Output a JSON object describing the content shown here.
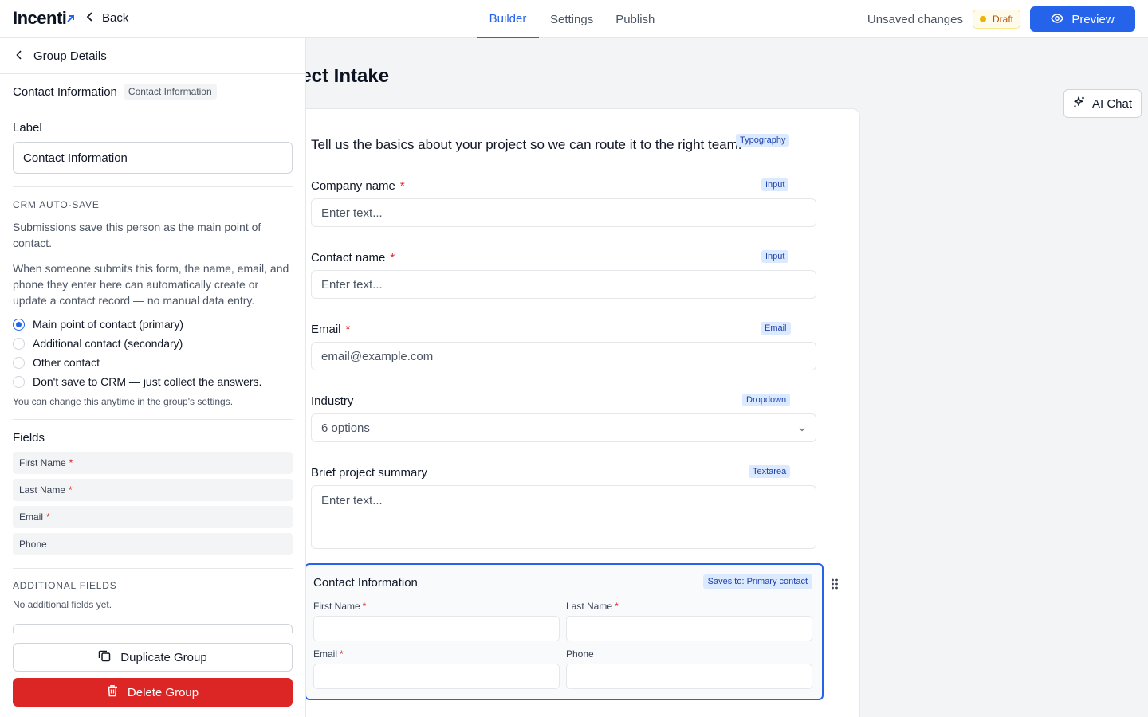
{
  "topbar": {
    "logo": "Incenti",
    "back_label": "Back",
    "tabs": [
      {
        "label": "Builder",
        "active": true
      },
      {
        "label": "Settings",
        "active": false
      },
      {
        "label": "Publish",
        "active": false
      }
    ],
    "unsaved_label": "Unsaved changes",
    "status_badge": "Draft",
    "preview_label": "Preview"
  },
  "sidebar": {
    "header_label": "Group Details",
    "group_title": "Contact Information",
    "group_tag": "Contact Information",
    "label_heading": "Label",
    "label_value": "Contact Information",
    "crm_heading": "CRM AUTO-SAVE",
    "crm_desc": "Submissions save this person as the main point of contact.",
    "crm_desc2": "When someone submits this form, the name, email, and phone they enter here can automatically create or update a contact record — no manual data entry.",
    "radio_options": [
      {
        "label": "Main point of contact (primary)",
        "selected": true
      },
      {
        "label": "Additional contact (secondary)",
        "selected": false
      },
      {
        "label": "Other contact",
        "selected": false
      },
      {
        "label": "Don't save to CRM — just collect the answers.",
        "selected": false
      }
    ],
    "crm_hint": "You can change this anytime in the group's settings.",
    "fields_heading": "Fields",
    "fields": [
      {
        "label": "First Name",
        "required_mark": "*"
      },
      {
        "label": "Last Name",
        "required_mark": "*"
      },
      {
        "label": "Email",
        "required_mark": "*"
      },
      {
        "label": "Phone",
        "required_mark": ""
      }
    ],
    "additional_heading": "ADDITIONAL FIELDS",
    "additional_empty": "No additional fields yet.",
    "duplicate_label": "Duplicate Group",
    "delete_label": "Delete Group"
  },
  "canvas": {
    "form_title": "oject Intake",
    "ai_chat_label": "AI Chat",
    "intro_text": "Tell us the basics about your project so we can route it to the right team.",
    "intro_tag": "Typography",
    "fields": [
      {
        "label": "Company name",
        "required_mark": "*",
        "tag": "Input",
        "placeholder": "Enter text..."
      },
      {
        "label": "Contact name",
        "required_mark": "*",
        "tag": "Input",
        "placeholder": "Enter text..."
      },
      {
        "label": "Email",
        "required_mark": "*",
        "tag": "Email",
        "placeholder": "email@example.com"
      },
      {
        "label": "Industry",
        "required_mark": "",
        "tag": "Dropdown",
        "placeholder": "6 options"
      },
      {
        "label": "Brief project summary",
        "required_mark": "",
        "tag": "Textarea",
        "placeholder": "Enter text..."
      }
    ],
    "group": {
      "title": "Contact Information",
      "saves_tag": "Saves to: Primary contact",
      "fields": [
        {
          "label": "First Name",
          "required_mark": "*"
        },
        {
          "label": "Last Name",
          "required_mark": "*"
        },
        {
          "label": "Email",
          "required_mark": "*"
        },
        {
          "label": "Phone",
          "required_mark": ""
        }
      ]
    }
  },
  "colors": {
    "accent": "#2563eb",
    "danger": "#dc2626",
    "draft": "#eab308"
  }
}
